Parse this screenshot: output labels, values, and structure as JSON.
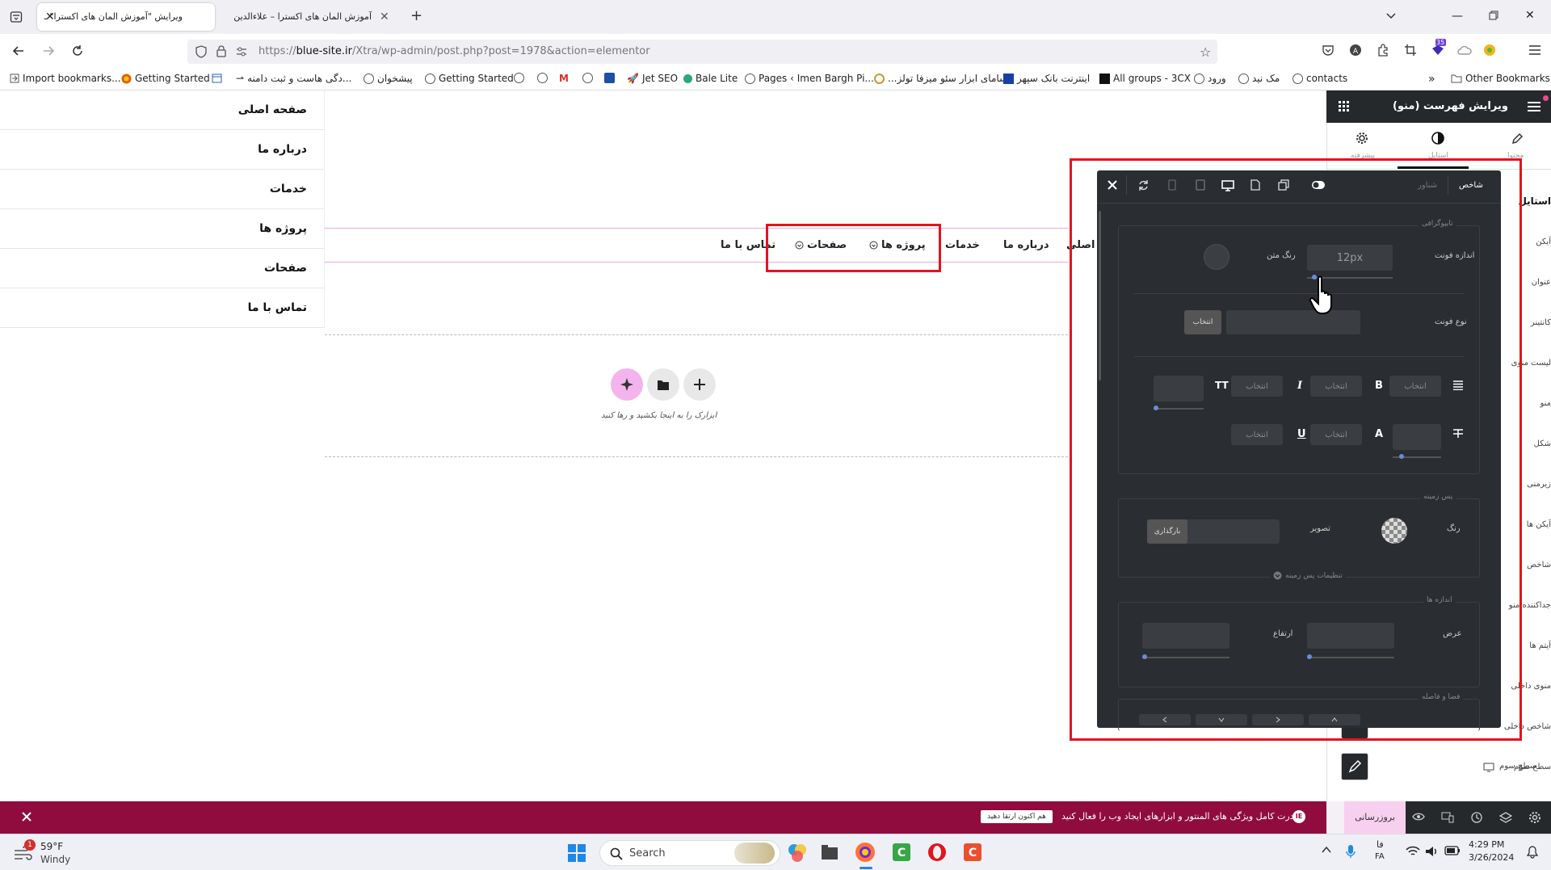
{
  "browser": {
    "tabs": [
      {
        "title": "ویرایش \"آموزش المان های اکسترا\" ـ"
      },
      {
        "title": "آموزش المان های اکسترا – علاءالدین"
      }
    ],
    "new_tab": "+",
    "url_prefix": "https://",
    "url_host": "blue-site.ir",
    "url_path": "/Xtra/wp-admin/post.php?post=1978&action=elementor",
    "ext_badge": "35",
    "bookmarks": [
      {
        "label": "Import bookmarks..."
      },
      {
        "label": "Getting Started"
      },
      {
        "label": ""
      },
      {
        "label": "...دگی هاست و ثبت دامنه"
      },
      {
        "label": "پیشخوان"
      },
      {
        "label": "Getting Started"
      },
      {
        "label": ""
      },
      {
        "label": ""
      },
      {
        "label": ""
      },
      {
        "label": ""
      },
      {
        "label": ""
      },
      {
        "label": "Jet SEO"
      },
      {
        "label": "Bale Lite"
      },
      {
        "label": "Pages ‹ Imen Bargh Pi..."
      },
      {
        "label": "...سامای ابزار سئو میزفا تولز"
      },
      {
        "label": "اینترنت بانک سپهر"
      },
      {
        "label": "All groups - 3CX"
      },
      {
        "label": "ورود"
      },
      {
        "label": "مک نید"
      },
      {
        "label": "contacts"
      }
    ],
    "bm_more": "»",
    "other_bookmarks": "Other Bookmarks"
  },
  "menu_items": [
    "صفحه اصلی",
    "درباره ما",
    "خدمات",
    "پروژه ها",
    "صفحات",
    "تماس با ما"
  ],
  "canvas": {
    "nav": [
      "ه اصلی",
      "درباره ما",
      "خدمات",
      "پروژه ها",
      "صفحات",
      "تماس با ما"
    ],
    "drop_text": "ابزارک را به اینجا بکشید و رها کنید"
  },
  "editor": {
    "title": "ویرایش فهرست (منو)",
    "tab_content": "محتوا",
    "tab_style": "استایل",
    "tab_advanced": "پیشرفته",
    "section_style": "استایل",
    "side_labels": [
      "آیکن",
      "عنوان",
      "کانتینر",
      "لیست منوی",
      "منو",
      "شکل",
      "زیرمنی",
      "آیکن ها",
      "شاخص",
      "جداکننده منو",
      "آیتم ها",
      "منوی داخلی",
      "شاخص داخلی",
      "سطح سوم"
    ]
  },
  "panel": {
    "tab_normal": "شاخص",
    "tab_hover": "شناور",
    "typography_label": "تایپوگرافی",
    "font_size_label": "اندازه فونت",
    "font_size_value": "12px",
    "text_color_label": "رنگ متن",
    "font_type_label": "نوع فونت",
    "select_btn": "انتخاب",
    "choose": "انتخاب",
    "bold": "B",
    "italic": "I",
    "underline": "U",
    "fontcase": "A",
    "bg_label": "پس زمینه",
    "color_label": "رنگ",
    "image_label": "تصویر",
    "upload_btn": "بارگذاری",
    "bg_settings": "تنظیمات پس زمینه",
    "size_label": "اندازه ها",
    "width_label": "عرض",
    "height_label": "ارتفاع",
    "spacing_label": "فضا و فاصله"
  },
  "notice": {
    "text": "قدرت کامل ویژگی های المنتور و ابزارهای ایجاد وب را فعال کنید.",
    "button": "هم اکنون ارتقا دهید",
    "update": "بروزرسانی"
  },
  "taskbar": {
    "weather_temp": "59°F",
    "weather_desc": "Windy",
    "weather_badge": "1",
    "search": "Search",
    "lang1": "فا",
    "lang2": "FA",
    "time": "4:29 PM",
    "date": "3/26/2024"
  }
}
